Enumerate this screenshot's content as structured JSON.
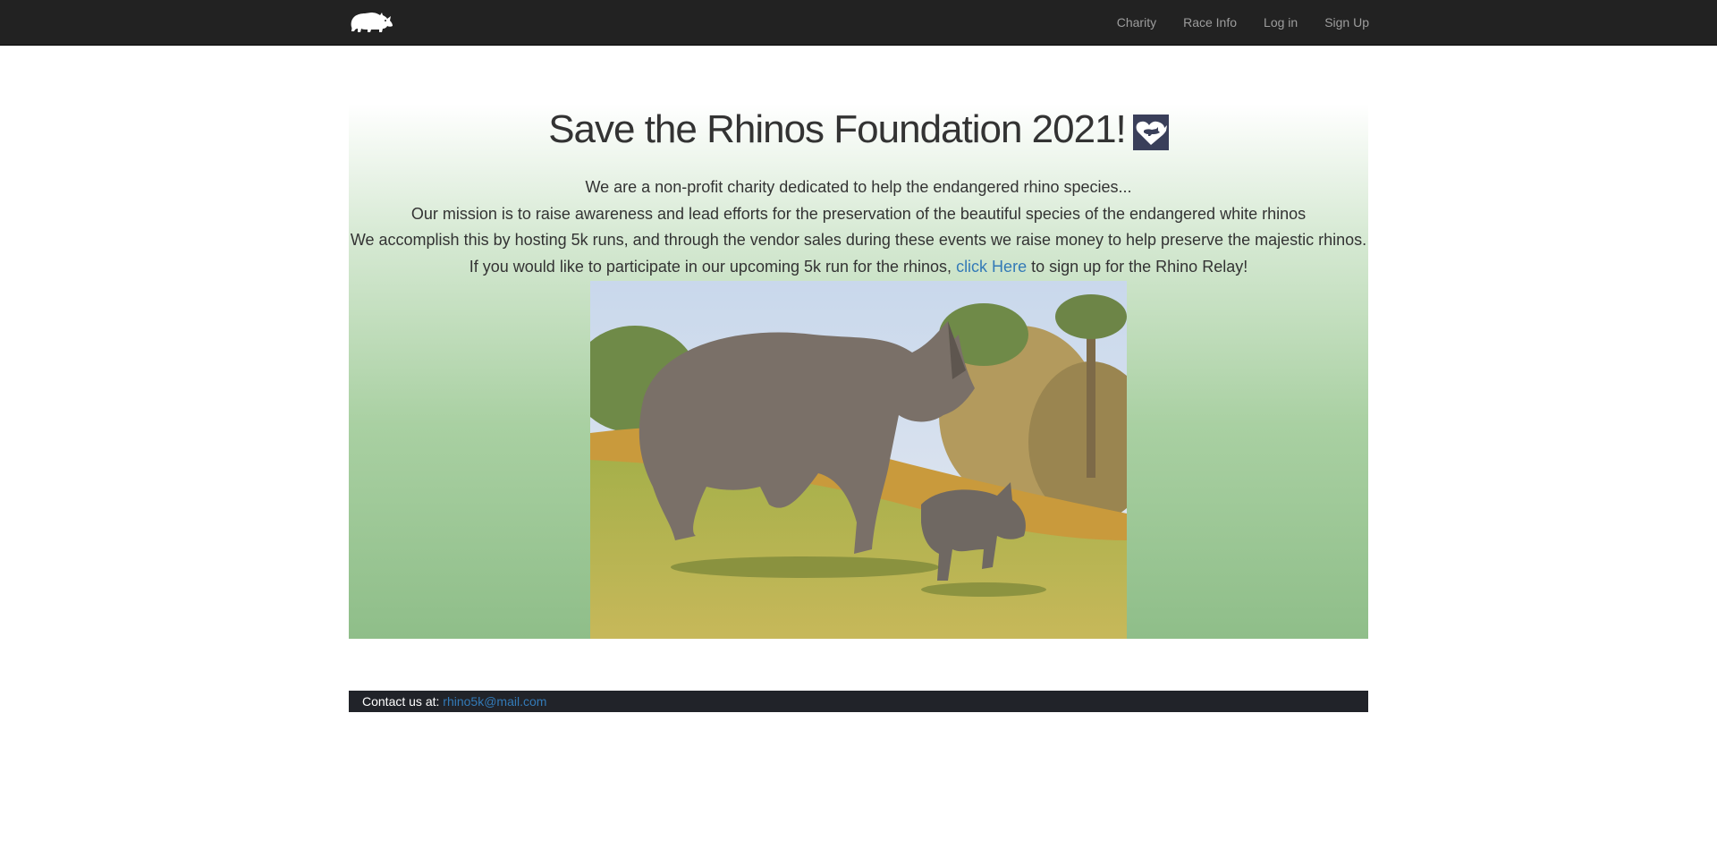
{
  "navbar": {
    "brand_icon": "rhino-logo-icon",
    "links": [
      {
        "label": "Charity"
      },
      {
        "label": "Race Info"
      },
      {
        "label": "Log in"
      },
      {
        "label": "Sign Up"
      }
    ]
  },
  "hero": {
    "title": "Save the Rhinos Foundation 2021!",
    "title_icon": "heart-rhino-icon",
    "lines": [
      "We are a non-profit charity dedicated to help the endangered rhino species...",
      "Our mission is to raise awareness and lead efforts for the preservation of the beautiful species of the endangered white rhinos",
      "We accomplish this by hosting 5k runs, and through the vendor sales during these events we raise money to help preserve the majestic rhinos."
    ],
    "signup_line": {
      "before": "If you would like to participate in our upcoming 5k run for the rhinos, ",
      "link": "click Here",
      "after": " to sign up for the Rhino Relay!"
    },
    "image": "rhino-mother-and-calf-photo"
  },
  "footer": {
    "label": "Contact us at: ",
    "email": "rhino5k@mail.com"
  },
  "colors": {
    "navbar_bg": "#222222",
    "nav_link": "#9d9d9d",
    "link": "#337ab7",
    "footer_bg": "#212329",
    "gradient_top": "#ffffff",
    "gradient_bottom": "#8fbe89"
  }
}
